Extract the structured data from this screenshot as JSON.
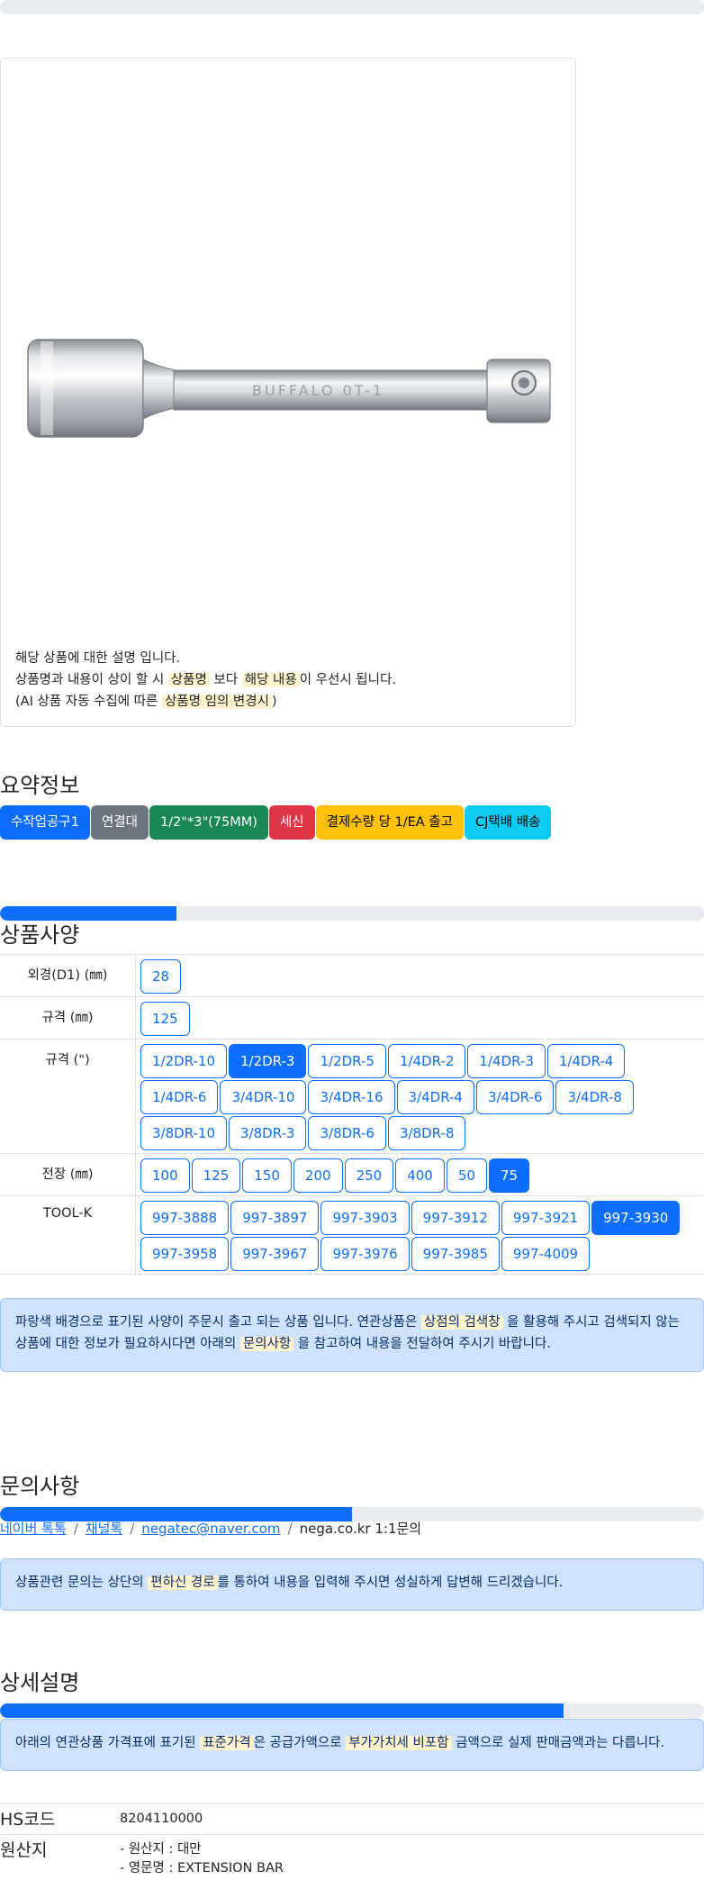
{
  "image_caption": {
    "line1": "해당 상품에 대한 설명 입니다.",
    "line2_a": "상품명과 내용이 상이 할 시 ",
    "line2_hl1": "상품명",
    "line2_b": " 보다 ",
    "line2_hl2": "해당 내용",
    "line2_c": "이 우선시 됩니다.",
    "line3_a": "(AI 상품 자동 수집에 따른 ",
    "line3_hl": "상품명 임의 변경시",
    "line3_b": ")"
  },
  "product_marking": "BUFFALO 0T-1",
  "summary": {
    "title": "요약정보",
    "badges": [
      {
        "label": "수작업공구1",
        "color": "#0d6efd"
      },
      {
        "label": "연결대",
        "color": "#6c757d"
      },
      {
        "label": "1/2\"*3\"(75MM)",
        "color": "#198754"
      },
      {
        "label": "세신",
        "color": "#dc3545"
      },
      {
        "label": "결제수량 당 1/EA 출고",
        "color": "#ffc107",
        "text_color": "#000000"
      },
      {
        "label": "CJ택배 배송",
        "color": "#0dcaf0",
        "text_color": "#000000"
      }
    ],
    "progress": 0.25
  },
  "spec": {
    "title": "상품사양",
    "rows": [
      {
        "label": "외경(D1) (㎜)",
        "options": [
          "28"
        ],
        "selected": []
      },
      {
        "label": "규격 (㎜)",
        "options": [
          "125"
        ],
        "selected": []
      },
      {
        "label": "규격 (\")",
        "options": [
          "1/2DR-10",
          "1/2DR-3",
          "1/2DR-5",
          "1/4DR-2",
          "1/4DR-3",
          "1/4DR-4",
          "1/4DR-6",
          "3/4DR-10",
          "3/4DR-16",
          "3/4DR-4",
          "3/4DR-6",
          "3/4DR-8",
          "3/8DR-10",
          "3/8DR-3",
          "3/8DR-6",
          "3/8DR-8"
        ],
        "selected": [
          "1/2DR-3"
        ]
      },
      {
        "label": "전장 (㎜)",
        "options": [
          "100",
          "125",
          "150",
          "200",
          "250",
          "400",
          "50",
          "75"
        ],
        "selected": [
          "75"
        ]
      },
      {
        "label": "TOOL-K",
        "options": [
          "997-3888",
          "997-3897",
          "997-3903",
          "997-3912",
          "997-3921",
          "997-3930",
          "997-3958",
          "997-3967",
          "997-3976",
          "997-3985",
          "997-4009"
        ],
        "selected": [
          "997-3930"
        ]
      }
    ],
    "notice_a": "파랑색 배경으로 표기된 사양이 주문시 출고 되는 상품 입니다. 연관상품은 ",
    "notice_hl1": "상점의 검색창",
    "notice_b": " 을 활용해 주시고 검색되지 않는 상품에 대한 정보가 필요하시다면 아래의 ",
    "notice_hl2": "문의사항",
    "notice_c": " 을 참고하여 내용을 전달하여 주시기 바랍니다."
  },
  "inquiry": {
    "title": "문의사항",
    "progress": 0.5,
    "links": [
      "네이버 톡톡",
      "채널톡",
      "negatec@naver.com"
    ],
    "last": "nega.co.kr 1:1문의",
    "separator": "/",
    "notice_a": "상품관련 문의는 상단의 ",
    "notice_hl": "편하신 경로",
    "notice_b": "를 통하여 내용을 입력해 주시면 성실하게 답변해 드리겠습니다."
  },
  "detail": {
    "title": "상세설명",
    "progress": 0.8,
    "notice_a": "아래의 연관상품 가격표에 표기된 ",
    "notice_hl1": "표준가격",
    "notice_b": "은 공급가액으로 ",
    "notice_hl2": "부가가치세 비포함",
    "notice_c": " 금액으로 실제 판매금액과는 다릅니다."
  },
  "info": {
    "hs_label": "HS코드",
    "hs_value": "8204110000",
    "origin_label": "원산지",
    "origin_line1": "- 원산지 : 대만",
    "origin_line2": "- 영문명 : EXTENSION BAR"
  }
}
